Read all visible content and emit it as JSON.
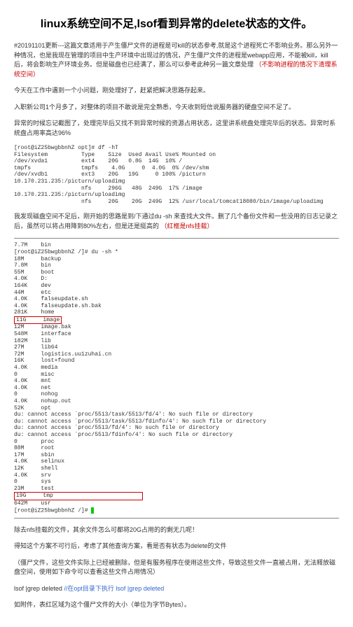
{
  "title": "linux系统空间不足,lsof看到异常的delete状态的文件。",
  "update_prefix": "#20191101更新---这篇文章适用于产生僵尸文件的进程是可kill的状态参考,就是这个进程死亡不影响业务。那么另外一种情况，也是我现在管理的项目中生产环境中出现过的情况，产生僵尸文件的进程是webapp应用，不能被kill，kill后，将会影响生产环境业务。但是磁盘也已经满了，那么可以参考此种另一篇文章处理",
  "update_red": "（不影响进程的情况下清理系统空间）",
  "p1": "今天在工作中遇到一个小问题，刚处理好了，赶紧把解决思路存起来。",
  "p2": "入职新公司1个月多了，对整体的项目不敢说是完全熟悉，今天收到短信说服务器的硬盘空间不足了。",
  "p3": "异常的时候忘记截图了，处理完毕后又找不到异常时候的资源占用状态，这里讲系统盘处理完毕后的状态。异常时系统盘占用率高达96%",
  "df_output": "[root@iZ25bwgbbnhZ opt]# df -hT\nFilesystem          Type    Size  Used Avail Use% Mounted on\n/dev/xvda1          ext4    20G   0.8G  14G  10% /\ntmpfs               tmpfs    4.0G     0  4.0G  0% /dev/shm\n/dev/xvdb1          ext3    20G   19G     0 100% /picturn\n10.170.231.235:/picturn/uploadimg\n                    nfs     296G   48G  249G  17% /image\n10.170.231.235:/picturn/uploadimg\n                    nfs     20G    20G  249G  12% /usr/local/tomcat18080/bin/image/uploadimg",
  "p4_a": "我发现磁盘空间不足后，刚开始的思路是到/下通过du -sh 来查找大文件。删了几个备份文件和一些没用的日志记录之后，虽然可以将占用降到80%左右，但是还是挺高的",
  "p4_b": "（红框是nfs挂载）",
  "du_header": "[root@iZ25bwgbbnhZ /]# du -sh *",
  "du_lines": {
    "l1": "7.7M    bin",
    "l2": "18M     backup",
    "l3": "7.8M    bin",
    "l4": "55M     boot",
    "l5": "4.0K    D:",
    "l6": "164K    dev",
    "l7": "44M     etc",
    "l8": "4.0K    falseupdate.sh",
    "l9": "4.0K    falseupdate.sh.bak",
    "l10": "281K    home",
    "l11a": "11G",
    "l11b": "image",
    "l12": "12M     image.bak",
    "l13": "548M    interface",
    "l14": "182M    lib",
    "l15": "27M     lib64",
    "l16": "72M     logistics.uu1zuhai.cn",
    "l17": "16K     lost+found",
    "l18": "4.0K    media",
    "l19": "0       misc",
    "l20": "4.0K    mnt",
    "l21": "4.0K    net",
    "l22": "0       nohog",
    "l23": "4.0K    nohup.out",
    "l24": "52K     opt",
    "err1": "du: cannot access `proc/5513/task/5513/fd/4': No such file or directory",
    "err2": "du: cannot access `proc/5513/task/5513/fdinfo/4': No such file or directory",
    "err3": "du: cannot access `proc/5513/fd/4': No such file or directory",
    "err4": "du: cannot access `proc/5513/fdinfo/4': No such file or directory",
    "l25": "0       proc",
    "l26": "88M     root",
    "l27": "17M     sbin",
    "l28": "4.0K    selinux",
    "l29": "12K     shell",
    "l30": "4.0K    srv",
    "l31": "0       sys",
    "l32": "23M     test",
    "l33a": "19G",
    "l33b": "tmp",
    "l34": "642M    usr",
    "prompt": "[root@iZ25bwgbbnhZ /]#"
  },
  "p5": "除去nfs挂载的文件，其余文件怎么可都将20G占用的的剩无几呢！",
  "p6": "得知这个方案不可行后，考虑了其他查询方案，看是否有状态为delete的文件",
  "p7": "（僵尸文件，这些文件实际上已经被删除，但是有服务程序在使用这些文件，导致这些文件一直被占用，无法释放磁盘空间，使用如下命令可以查看这些文件占用情况）",
  "cmd": "lsof |grep deleted",
  "cmd_note": " //在opt目录下执行 lsof |grep deleted",
  "p8": "如附件，表红区域为这个僵尸文件的大小（单位为字节Bytes）。"
}
